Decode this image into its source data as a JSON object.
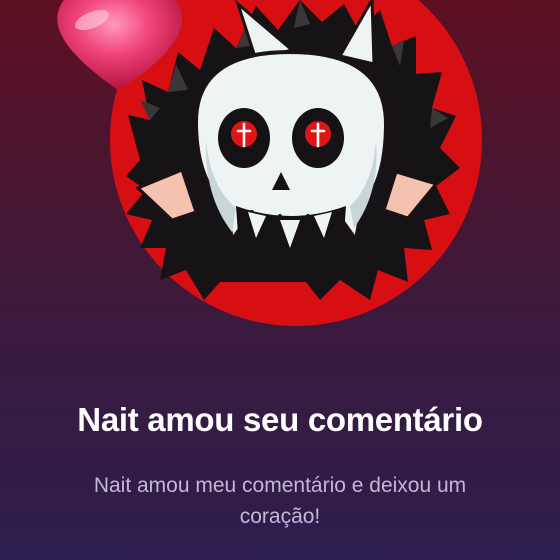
{
  "notification": {
    "title": "Nait amou seu comentário",
    "message": "Nait amou meu comentário e deixou um coração!"
  },
  "avatar": {
    "icon": "skull-monster-avatar-icon",
    "background_color": "#d80f12"
  },
  "decoration": {
    "icon": "heart-icon",
    "color": "#e8366a"
  }
}
